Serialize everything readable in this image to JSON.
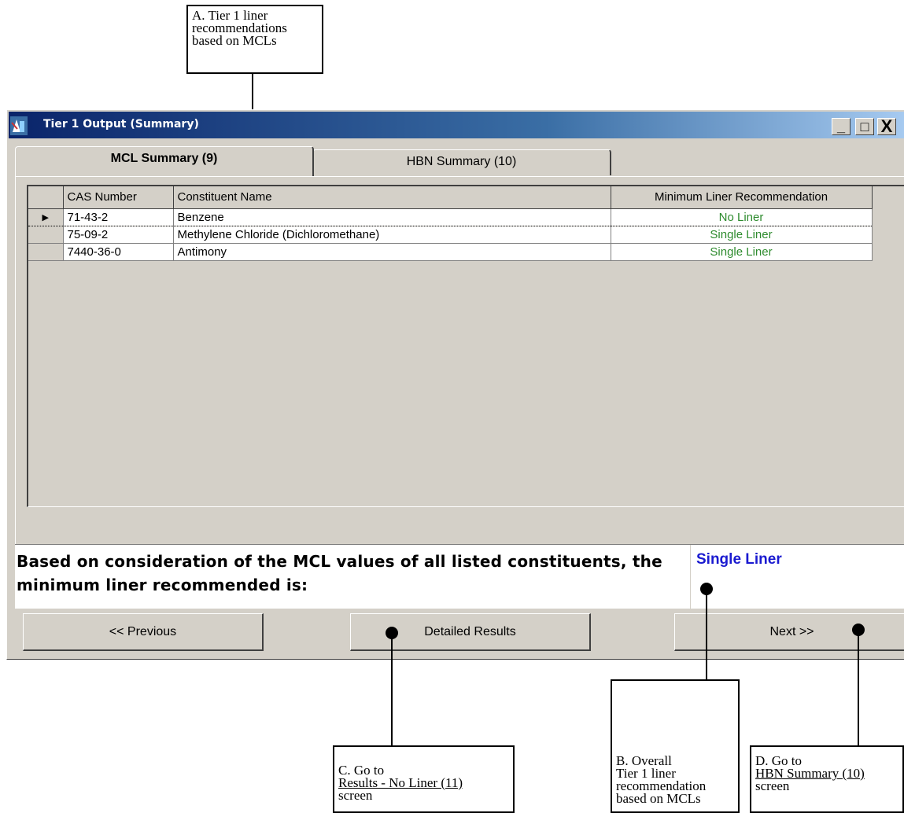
{
  "callouts": {
    "a": [
      "A. Tier 1 liner",
      "recommendations",
      "based on MCLs"
    ],
    "b": [
      "B. Overall",
      "Tier 1 liner",
      "recommendation",
      "based on MCLs"
    ],
    "c": {
      "line1": "C. Go to",
      "line2": "Results - No Liner (11)",
      "line3": "screen"
    },
    "d": {
      "line1": "D. Go to",
      "line2": "HBN Summary (10)",
      "line3": "screen"
    }
  },
  "window": {
    "title": "Tier 1 Output (Summary)",
    "controls": {
      "minimize": "_",
      "maximize": "□",
      "close": "X"
    }
  },
  "tabs": [
    {
      "label": "MCL Summary (9)",
      "active": true
    },
    {
      "label": "HBN Summary (10)",
      "active": false
    }
  ],
  "grid": {
    "headers": [
      "CAS Number",
      "Constituent Name",
      "Minimum Liner Recommendation"
    ],
    "rows": [
      {
        "selector": "▶",
        "cas": "71-43-2",
        "name": "Benzene",
        "rec": "No Liner"
      },
      {
        "selector": "",
        "cas": "75-09-2",
        "name": "Methylene Chloride (Dichloromethane)",
        "rec": "Single Liner"
      },
      {
        "selector": "",
        "cas": "7440-36-0",
        "name": "Antimony",
        "rec": "Single Liner"
      }
    ]
  },
  "summary": {
    "message": "Based on consideration of the MCL values of all listed constituents, the minimum liner recommended is:",
    "result": "Single Liner"
  },
  "buttons": {
    "previous": "<< Previous",
    "detailed": "Detailed Results",
    "next": "Next >>"
  },
  "colors": {
    "result_text": "#1a1ad0",
    "recommendation_text": "#2e8b2e",
    "titlebar": "#0a246a"
  }
}
